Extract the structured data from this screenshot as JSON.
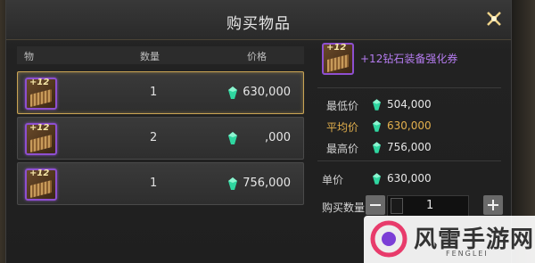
{
  "dialog": {
    "title": "购买物品"
  },
  "list": {
    "headers": {
      "item": "物",
      "quantity": "数量",
      "price": "价格"
    },
    "rows": [
      {
        "plus": "+12",
        "quantity": "1",
        "price": "630,000",
        "selected": true
      },
      {
        "plus": "+12",
        "quantity": "2",
        "price": ",000",
        "selected": false
      },
      {
        "plus": "+12",
        "quantity": "1",
        "price": "756,000",
        "selected": false
      }
    ]
  },
  "detail": {
    "icon_plus": "+12",
    "item_name": "+12钻石装备强化券",
    "stats": {
      "min_label": "最低价",
      "min_value": "504,000",
      "avg_label": "平均价",
      "avg_value": "630,000",
      "max_label": "最高价",
      "max_value": "756,000"
    },
    "unit_price_label": "单价",
    "unit_price_value": "630,000",
    "buy_qty_label": "购买数量",
    "buy_qty_value": "1"
  },
  "watermark": {
    "text": "风雷手游网",
    "sub": "FENGLEI"
  },
  "colors": {
    "accent_gold": "#e3b04d",
    "item_purple": "#b57cf0",
    "gem_green": "#2fd6a0"
  },
  "icons": {
    "close": "close-icon",
    "gem": "gem-icon",
    "calculator": "calculator-icon",
    "minus": "minus-icon",
    "plus": "plus-icon"
  }
}
